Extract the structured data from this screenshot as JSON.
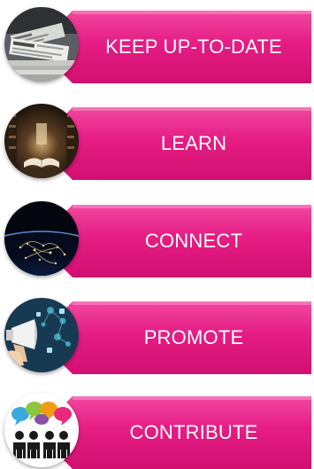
{
  "items": [
    {
      "label": "KEEP UP-TO-DATE",
      "icon": "newspaper-stack-icon"
    },
    {
      "label": "LEARN",
      "icon": "library-book-icon"
    },
    {
      "label": "CONNECT",
      "icon": "globe-network-icon"
    },
    {
      "label": "PROMOTE",
      "icon": "megaphone-icon"
    },
    {
      "label": "CONTRIBUTE",
      "icon": "people-speech-bubbles-icon"
    }
  ],
  "colors": {
    "tab_light": "#f1489f",
    "tab_mid": "#e51c84",
    "tab_dark": "#d21070",
    "label_text": "#ffffff"
  }
}
